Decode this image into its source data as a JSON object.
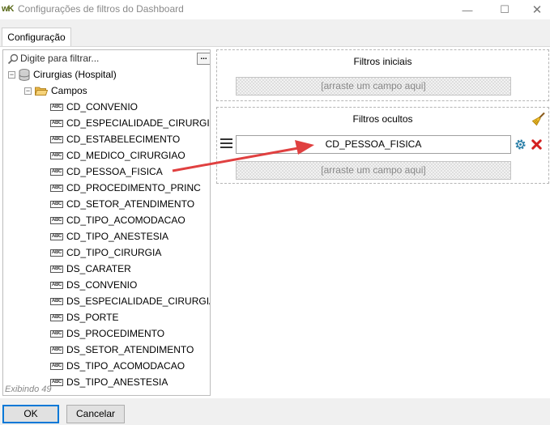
{
  "window": {
    "app_icon": "wK",
    "title": "Configurações de filtros do Dashboard",
    "minimize_glyph": "—",
    "maximize_glyph": "☐",
    "close_glyph": "✕"
  },
  "tabs": [
    {
      "label": "Configuração",
      "active": true
    }
  ],
  "tree": {
    "filter_placeholder": "Digite para filtrar...",
    "more_button": "...",
    "root": {
      "label": "Cirurgias (Hospital)",
      "icon": "database-icon",
      "expanded": true
    },
    "folder": {
      "label": "Campos",
      "icon": "folder-open-icon",
      "expanded": true
    },
    "field_icon_text": "ABC",
    "fields": [
      "CD_CONVENIO",
      "CD_ESPECIALIDADE_CIRURGIAO",
      "CD_ESTABELECIMENTO",
      "CD_MEDICO_CIRURGIAO",
      "CD_PESSOA_FISICA",
      "CD_PROCEDIMENTO_PRINC",
      "CD_SETOR_ATENDIMENTO",
      "CD_TIPO_ACOMODACAO",
      "CD_TIPO_ANESTESIA",
      "CD_TIPO_CIRURGIA",
      "DS_CARATER",
      "DS_CONVENIO",
      "DS_ESPECIALIDADE_CIRURGIAO",
      "DS_PORTE",
      "DS_PROCEDIMENTO",
      "DS_SETOR_ATENDIMENTO",
      "DS_TIPO_ACOMODACAO",
      "DS_TIPO_ANESTESIA"
    ],
    "status": "Exibindo 49"
  },
  "initial_filters": {
    "title": "Filtros iniciais",
    "drop_placeholder": "[arraste um campo aqui]"
  },
  "hidden_filters": {
    "title": "Filtros ocultos",
    "items": [
      {
        "field": "CD_PESSOA_FISICA"
      }
    ],
    "drop_placeholder": "[arraste um campo aqui]"
  },
  "annotation": {
    "arrow_color": "#e04040"
  },
  "buttons": {
    "ok": "OK",
    "cancel": "Cancelar"
  },
  "colors": {
    "accent": "#0078d7",
    "delete": "#d42020",
    "gear": "#2a7fa8"
  }
}
